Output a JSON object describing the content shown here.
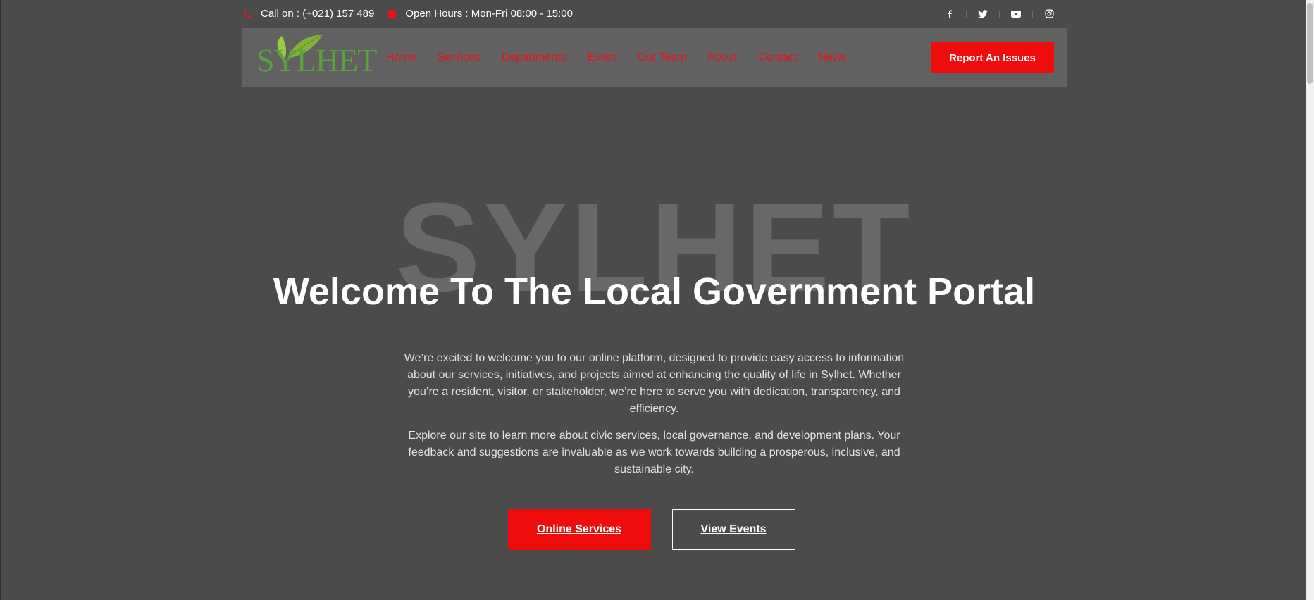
{
  "topbar": {
    "phone": "Call on : (+021) 157 489",
    "hours": "Open Hours : Mon-Fri 08:00 - 15:00",
    "socials": [
      "facebook-icon",
      "twitter-icon",
      "youtube-icon",
      "instagram-icon"
    ]
  },
  "header": {
    "logo_text": "SYLHET",
    "nav": [
      "Home",
      "Services",
      "Departments",
      "Event",
      "Our Team",
      "About",
      "Contact",
      "News"
    ],
    "report_button": "Report An Issues"
  },
  "hero": {
    "watermark": "SYLHET",
    "title": "Welcome To The Local Government Portal",
    "paragraph1": "We’re excited to welcome you to our online platform, designed to provide easy access to information about our services, initiatives, and projects aimed at enhancing the quality of life in Sylhet. Whether you’re a resident, visitor, or stakeholder, we’re here to serve you with dedication, transparency, and efficiency.",
    "paragraph2": "Explore our site to learn more about civic services, local governance, and development plans. Your feedback and suggestions are invaluable as we work towards building a prosperous, inclusive, and sustainable city.",
    "primary_button": "Online Services",
    "secondary_button": "View Events"
  },
  "colors": {
    "accent": "#ee0c0c",
    "nav_link": "#e8141a",
    "background": "#4b4b4b",
    "navbar": "#616161",
    "logo_green": "#5aa33a"
  }
}
